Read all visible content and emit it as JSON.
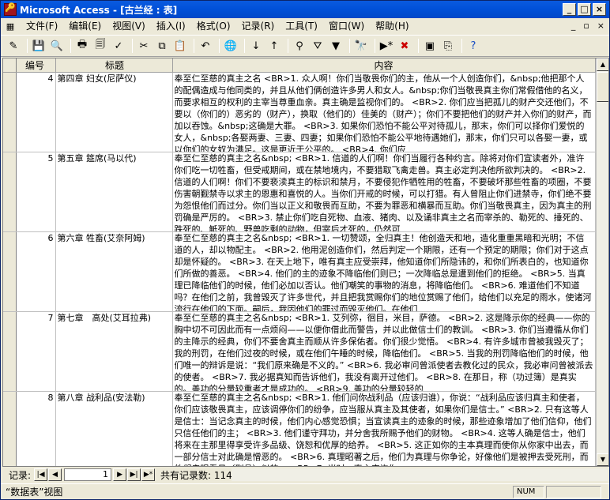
{
  "window": {
    "title": "Microsoft Access - [古兰经 : 表]"
  },
  "menu": [
    "文件(F)",
    "编辑(E)",
    "视图(V)",
    "插入(I)",
    "格式(O)",
    "记录(R)",
    "工具(T)",
    "窗口(W)",
    "帮助(H)"
  ],
  "columns": {
    "num": "编号",
    "title": "标题",
    "content": "内容"
  },
  "rows": [
    {
      "num": "4",
      "title": "第四章 妇女(尼萨仪)",
      "content": "奉至仁至慈的真主之名 <BR>1. 众人啊！你们当敬畏你们的主，他从一个人创造你们，&nbsp;他把那个人的配偶造成与他同类的，并且从他们俩创造许多男人和女人。&nbsp;你们当敬畏真主你们常假借他的名义，而要求相互的权利的主宰当尊重血亲。真主确是监视你们的。 <BR>2. 你们应当把孤儿的财产交还他们，不要以（你们的）恶劣的（财产），换取（他们的）佳美的（财产）；你们不要把他们的财产并入你们的财产，而加以吞蚀。&nbsp;这确是大罪。 <BR>3. 如果你们恐怕不能公平对待孤儿，那末，你们可以择你们爱悦的女人，&nbsp;各娶两妻、三妻、四妻；如果你们恐怕不能公平地待遇她们，那末，你们只可以各娶一妻，或以你们的女奴为满足。这是更近于公平的。 <BR>4. 你们应"
    },
    {
      "num": "5",
      "title": "第五章 筵席(马以代)",
      "content": "奉至仁至慈的真主之名&nbsp; <BR>1. 信道的人们啊！你们当履行各种约言。除将对你们宣读者外，准许你们吃一切牲畜，但受戒期间，或在禁地境内，不要猎取飞禽走兽。真主必定判决他所欲判决的。 <BR>2. 信道的人们啊！你们不要亵渎真主的标识和禁月，不要侵犯作牺牲用的牲畜，不要破坏那些牲畜的项圈，不要伤害朝觐禁寺以求主的恩惠和喜悦的人。当你们开戒的时候，可以打猎。有人曾阻止你们进禁寺，你们绝不要为怨恨他们而过分。你们当以正义和敬畏而互助，不要为罪恶和横暴而互助。你们当敬畏真主，因为真主的刑罚确是严厉的。 <BR>3. 禁止你们吃自死物、血液、猪肉、以及诵非真主之名而宰杀的、勒死的、捶死的、跌死的、觝死的、野兽吃剩的动物，但宰后才死的，仍然可"
    },
    {
      "num": "6",
      "title": "第六章 牲畜(艾奈阿姆)",
      "content": "奉至仁至慈的真主之名&nbsp; <BR>1. 一切赞颂，全归真主！他创造天和地，造化重重黑暗和光明；不信道的人，却以物配主。 <BR>2. 他用泥创造你们，然后判定一个期限，还有一个预定的期限；你们对于这点却是怀疑的。 <BR>3. 在天上地下，唯有真主应受崇拜，他知道你们所隐讳的，和你们所表白的，也知道你们所做的善恶。 <BR>4. 他们的主的迹象不降临他们则已；一次降临总是遭到他们的拒绝。 <BR>5. 当真理已降临他们的时候，他们必加以否认。他们嘲笑的事物的消息，将降临他们。 <BR>6. 难道他们不知道吗？在他们之前，我曾毁灭了许多世代，并且把我赏赐你们的地位赏赐了他们，给他们以充足的雨水，使诸河流行在他们的下面。嗣后，我因他们的罪过而毁灭他们。在他们"
    },
    {
      "num": "7",
      "title": "第七章　高处(艾耳拉弗)",
      "content": "奉至仁至慈的真主之名&nbsp; <BR>1. 艾列弥，徊目，米目，萨德。 <BR>2. 这是降示你的经典——你的胸中切不可因此而有一点烦闷——以便你借此而警告，并以此做信士们的教训。 <BR>3. 你们当遵循从你们的主降示的经典，你们不要舍真主而顺从许多保佑者。你们很少觉悟。 <BR>4. 有许多城市曾被我毁灭了；我的刑罚，在他们过夜的时候，或在他们午睡的时候，降临他们。 <BR>5. 当我的刑罚降临他们的时候，他们唯一的辩诉是说：“我们原来确是不义的。” <BR>6. 我必审问曾派使者去教化过的民众，我必审问曾被派去的使者。 <BR>7. 我必据真知而告诉他们，我没有离开过他们。 <BR>8. 在那日，称（功过簿）是真实的。善功的分量较重者才是成功的。 <BR>9. 善功的分量较轻的"
    },
    {
      "num": "8",
      "title": "第八章 战利品(安法勒)",
      "content": "奉至仁至慈的真主之名&nbsp; <BR>1. 他们问你战利品（应该归谁），你说：“战利品应该归真主和使者，你们应该敬畏真主，应该调停你们的纷争，应当服从真主及其使者，如果你们是信士。” <BR>2. 只有这等人是信士：当记念真主的时候，他们内心感觉恐惧；当宣读真主的迹象的时候，那些迹象增加了他们信仰，他们只信任他们的主； <BR>3. 他们谨守拜功，并分舍我所赐予他们的财物。 <BR>4. 这等人确是信士，他们将来在主那里得享受许多品级、饶恕和优厚的给养。 <BR>5. 这正如你的主本真理而使你从你家中出去，而一部分信士对此确是憎恶的。 <BR>6. 真理昭著之后，他们为真理与你争论，好像他们是被押去受死刑，而他们亲眼看见（刑具）似的。 <BR>7. 当时，真主应许你"
    }
  ],
  "nav": {
    "label": "记录:",
    "current": "1",
    "total_label": "共有记录数: 114"
  },
  "status": {
    "view": "“数据表”视图",
    "num": "NUM"
  }
}
